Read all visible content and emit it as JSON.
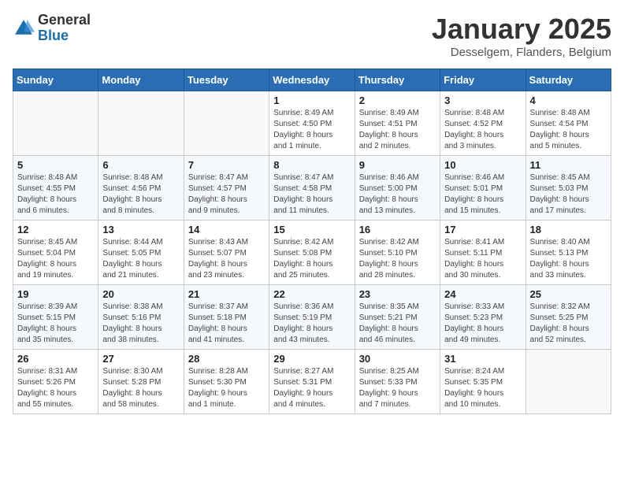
{
  "logo": {
    "general": "General",
    "blue": "Blue"
  },
  "header": {
    "title": "January 2025",
    "subtitle": "Desselgem, Flanders, Belgium"
  },
  "weekdays": [
    "Sunday",
    "Monday",
    "Tuesday",
    "Wednesday",
    "Thursday",
    "Friday",
    "Saturday"
  ],
  "weeks": [
    [
      {
        "day": "",
        "info": ""
      },
      {
        "day": "",
        "info": ""
      },
      {
        "day": "",
        "info": ""
      },
      {
        "day": "1",
        "info": "Sunrise: 8:49 AM\nSunset: 4:50 PM\nDaylight: 8 hours\nand 1 minute."
      },
      {
        "day": "2",
        "info": "Sunrise: 8:49 AM\nSunset: 4:51 PM\nDaylight: 8 hours\nand 2 minutes."
      },
      {
        "day": "3",
        "info": "Sunrise: 8:48 AM\nSunset: 4:52 PM\nDaylight: 8 hours\nand 3 minutes."
      },
      {
        "day": "4",
        "info": "Sunrise: 8:48 AM\nSunset: 4:54 PM\nDaylight: 8 hours\nand 5 minutes."
      }
    ],
    [
      {
        "day": "5",
        "info": "Sunrise: 8:48 AM\nSunset: 4:55 PM\nDaylight: 8 hours\nand 6 minutes."
      },
      {
        "day": "6",
        "info": "Sunrise: 8:48 AM\nSunset: 4:56 PM\nDaylight: 8 hours\nand 8 minutes."
      },
      {
        "day": "7",
        "info": "Sunrise: 8:47 AM\nSunset: 4:57 PM\nDaylight: 8 hours\nand 9 minutes."
      },
      {
        "day": "8",
        "info": "Sunrise: 8:47 AM\nSunset: 4:58 PM\nDaylight: 8 hours\nand 11 minutes."
      },
      {
        "day": "9",
        "info": "Sunrise: 8:46 AM\nSunset: 5:00 PM\nDaylight: 8 hours\nand 13 minutes."
      },
      {
        "day": "10",
        "info": "Sunrise: 8:46 AM\nSunset: 5:01 PM\nDaylight: 8 hours\nand 15 minutes."
      },
      {
        "day": "11",
        "info": "Sunrise: 8:45 AM\nSunset: 5:03 PM\nDaylight: 8 hours\nand 17 minutes."
      }
    ],
    [
      {
        "day": "12",
        "info": "Sunrise: 8:45 AM\nSunset: 5:04 PM\nDaylight: 8 hours\nand 19 minutes."
      },
      {
        "day": "13",
        "info": "Sunrise: 8:44 AM\nSunset: 5:05 PM\nDaylight: 8 hours\nand 21 minutes."
      },
      {
        "day": "14",
        "info": "Sunrise: 8:43 AM\nSunset: 5:07 PM\nDaylight: 8 hours\nand 23 minutes."
      },
      {
        "day": "15",
        "info": "Sunrise: 8:42 AM\nSunset: 5:08 PM\nDaylight: 8 hours\nand 25 minutes."
      },
      {
        "day": "16",
        "info": "Sunrise: 8:42 AM\nSunset: 5:10 PM\nDaylight: 8 hours\nand 28 minutes."
      },
      {
        "day": "17",
        "info": "Sunrise: 8:41 AM\nSunset: 5:11 PM\nDaylight: 8 hours\nand 30 minutes."
      },
      {
        "day": "18",
        "info": "Sunrise: 8:40 AM\nSunset: 5:13 PM\nDaylight: 8 hours\nand 33 minutes."
      }
    ],
    [
      {
        "day": "19",
        "info": "Sunrise: 8:39 AM\nSunset: 5:15 PM\nDaylight: 8 hours\nand 35 minutes."
      },
      {
        "day": "20",
        "info": "Sunrise: 8:38 AM\nSunset: 5:16 PM\nDaylight: 8 hours\nand 38 minutes."
      },
      {
        "day": "21",
        "info": "Sunrise: 8:37 AM\nSunset: 5:18 PM\nDaylight: 8 hours\nand 41 minutes."
      },
      {
        "day": "22",
        "info": "Sunrise: 8:36 AM\nSunset: 5:19 PM\nDaylight: 8 hours\nand 43 minutes."
      },
      {
        "day": "23",
        "info": "Sunrise: 8:35 AM\nSunset: 5:21 PM\nDaylight: 8 hours\nand 46 minutes."
      },
      {
        "day": "24",
        "info": "Sunrise: 8:33 AM\nSunset: 5:23 PM\nDaylight: 8 hours\nand 49 minutes."
      },
      {
        "day": "25",
        "info": "Sunrise: 8:32 AM\nSunset: 5:25 PM\nDaylight: 8 hours\nand 52 minutes."
      }
    ],
    [
      {
        "day": "26",
        "info": "Sunrise: 8:31 AM\nSunset: 5:26 PM\nDaylight: 8 hours\nand 55 minutes."
      },
      {
        "day": "27",
        "info": "Sunrise: 8:30 AM\nSunset: 5:28 PM\nDaylight: 8 hours\nand 58 minutes."
      },
      {
        "day": "28",
        "info": "Sunrise: 8:28 AM\nSunset: 5:30 PM\nDaylight: 9 hours\nand 1 minute."
      },
      {
        "day": "29",
        "info": "Sunrise: 8:27 AM\nSunset: 5:31 PM\nDaylight: 9 hours\nand 4 minutes."
      },
      {
        "day": "30",
        "info": "Sunrise: 8:25 AM\nSunset: 5:33 PM\nDaylight: 9 hours\nand 7 minutes."
      },
      {
        "day": "31",
        "info": "Sunrise: 8:24 AM\nSunset: 5:35 PM\nDaylight: 9 hours\nand 10 minutes."
      },
      {
        "day": "",
        "info": ""
      }
    ]
  ]
}
